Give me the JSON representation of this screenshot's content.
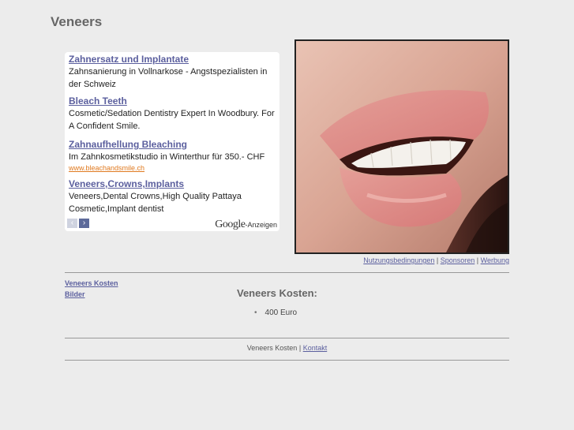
{
  "page": {
    "title": "Veneers"
  },
  "ads": [
    {
      "title": "Zahnersatz und Implantate",
      "text": "Zahnsanierung in Vollnarkose - Angstspezialisten in der Schweiz",
      "url": ""
    },
    {
      "title": "Bleach Teeth",
      "text": "Cosmetic/Sedation Dentistry Expert In Woodbury. For A Confident Smile.",
      "url": ""
    },
    {
      "title": "Zahnaufhellung Bleaching",
      "text": "Im Zahnkosmetikstudio in Winterthur für 350.- CHF",
      "url": "www.bleachandsmile.ch"
    },
    {
      "title": "Veneers,Crowns,Implants",
      "text": "Veneers,Dental Crowns,High Quality Pattaya Cosmetic,Implant dentist",
      "url": ""
    }
  ],
  "ad_nav": {
    "prev": "‹",
    "next": "›"
  },
  "ads_by": {
    "brand": "Google",
    "suffix": "-Anzeigen"
  },
  "image_links": {
    "terms": "Nutzungsbedingungen",
    "sponsors": "Sponsoren",
    "advertising": "Werbung",
    "sep": "|"
  },
  "left_nav": [
    "Veneers Kosten",
    "Bilder"
  ],
  "main": {
    "heading": "Veneers Kosten:",
    "items": [
      "400 Euro"
    ]
  },
  "footer": {
    "text": "Veneers Kosten",
    "sep": "|",
    "contact": "Kontakt"
  },
  "colors": {
    "background": "#ececec",
    "link": "#5b5f9e",
    "ad_url": "#e07a20"
  }
}
